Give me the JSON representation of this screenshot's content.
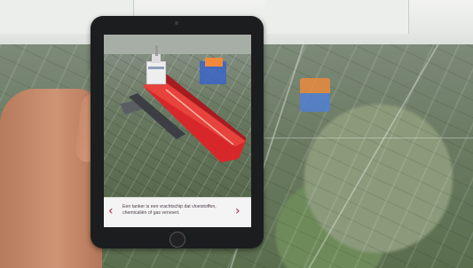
{
  "ar_app": {
    "caption": "Een tanker is een vrachtschip dat vloeistoffen, chemicaliën of gas vervoert.",
    "prev_glyph": "‹",
    "next_glyph": "›"
  },
  "icons": {
    "prev": "chevron-left-icon",
    "next": "chevron-right-icon"
  },
  "colors": {
    "accent_chevron": "#a1254a",
    "ship_hull": "#d8272a",
    "info_bar": "#f4f4f4"
  }
}
